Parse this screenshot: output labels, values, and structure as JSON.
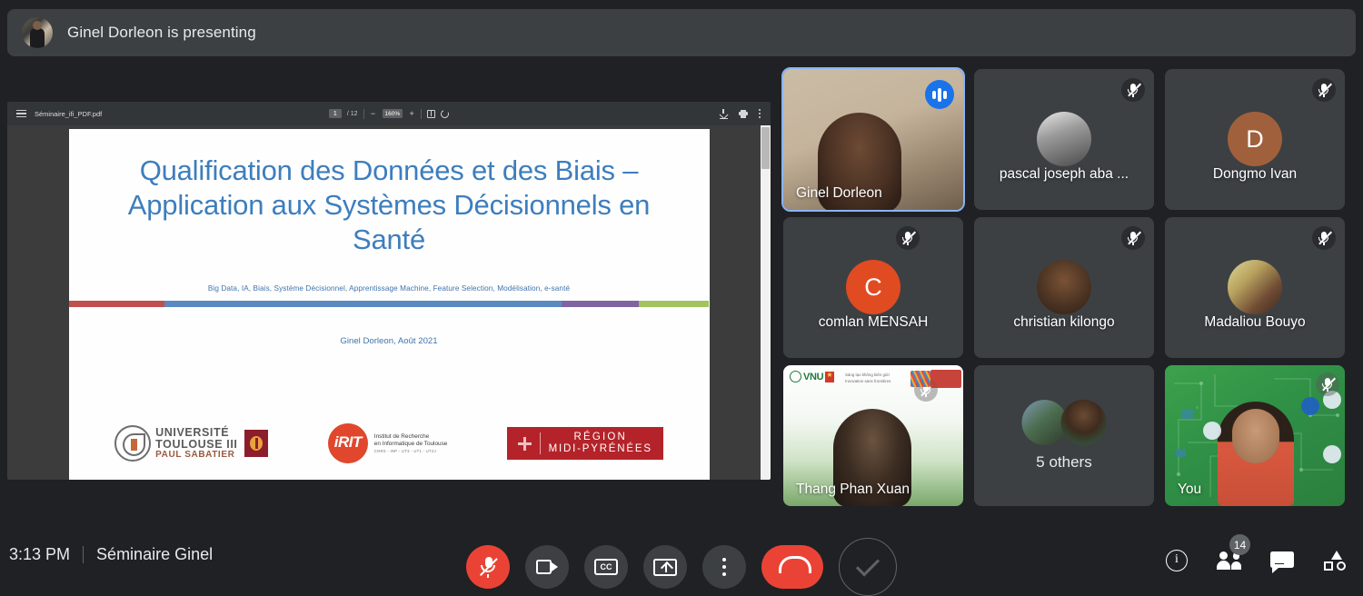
{
  "banner": {
    "text": "Ginel Dorleon is presenting",
    "avatar_icon": "presenter-avatar"
  },
  "pdf_viewer": {
    "menu_icon": "hamburger-menu-icon",
    "filename": "Séminaire_ifi_PDF.pdf",
    "current_page": "1",
    "page_total": "/ 12",
    "zoom_minus": "−",
    "zoom_level": "160%",
    "zoom_plus": "+",
    "fit_icon": "fit-to-page-icon",
    "rotate_icon": "rotate-icon",
    "download_icon": "download-icon",
    "print_icon": "print-icon",
    "more_icon": "more-options-icon"
  },
  "slide": {
    "title": "Qualification des Données et des Biais – Application aux Systèmes Décisionnels en Santé",
    "keywords": "Big Data, IA, Biais, Système Décisionnel, Apprentissage Machine, Feature Selection, Modélisation, e-santé",
    "author": "Ginel Dorleon, Août 2021",
    "color_bar": [
      {
        "color": "#c0504d",
        "width": "15%"
      },
      {
        "color": "#5b8ac1",
        "width": "62%"
      },
      {
        "color": "#8064a2",
        "width": "12%"
      },
      {
        "color": "#a3c35e",
        "width": "11%"
      }
    ],
    "logos": {
      "university": {
        "line1": "UNIVERSITÉ",
        "line2": "TOULOUSE III",
        "line3": "PAUL SABATIER"
      },
      "irit": {
        "mark": "iRIT",
        "sub1": "Institut de Recherche",
        "sub2": "en Informatique de Toulouse",
        "sub3": "CNRS - INP - UT3 - UT1 - UT2J"
      },
      "region": {
        "line1": "RÉGION",
        "line2": "MIDI-PYRÉNÉES"
      }
    }
  },
  "participants": [
    {
      "name": "Ginel Dorleon",
      "type": "video",
      "active": true,
      "speaking": true,
      "muted": false,
      "name_position": "bottom-left"
    },
    {
      "name": "pascal joseph aba ...",
      "type": "photo-avatar",
      "active": false,
      "speaking": false,
      "muted": true,
      "name_position": "centered"
    },
    {
      "name": "Dongmo Ivan",
      "type": "initial-avatar",
      "initial": "D",
      "avatar_color": "#a1603c",
      "active": false,
      "speaking": false,
      "muted": true,
      "name_position": "centered"
    },
    {
      "name": "comlan MENSAH",
      "type": "initial-avatar",
      "initial": "C",
      "avatar_color": "#e04b22",
      "active": false,
      "speaking": false,
      "muted": true,
      "name_position": "centered"
    },
    {
      "name": "christian kilongo",
      "type": "photo-avatar",
      "active": false,
      "speaking": false,
      "muted": true,
      "name_position": "centered"
    },
    {
      "name": "Madaliou Bouyo",
      "type": "photo-avatar",
      "active": false,
      "speaking": false,
      "muted": true,
      "name_position": "centered"
    },
    {
      "name": "Thang Phan Xuan",
      "type": "video",
      "active": false,
      "speaking": false,
      "muted": true,
      "name_position": "bottom-left"
    },
    {
      "name": "5 others",
      "type": "overflow",
      "active": false,
      "speaking": false,
      "muted": false,
      "name_position": "centered"
    },
    {
      "name": "You",
      "type": "video",
      "active": false,
      "speaking": false,
      "muted": true,
      "name_position": "bottom-left"
    }
  ],
  "bottom_bar": {
    "time": "3:13 PM",
    "meeting_name": "Séminaire Ginel",
    "controls": [
      {
        "name": "microphone-muted-button",
        "icon": "mic-off-icon",
        "style": "red"
      },
      {
        "name": "camera-button",
        "icon": "camera-icon",
        "style": "grey"
      },
      {
        "name": "captions-button",
        "icon": "closed-captions-icon",
        "label": "CC",
        "style": "grey"
      },
      {
        "name": "present-screen-button",
        "icon": "present-now-icon",
        "style": "grey"
      },
      {
        "name": "more-options-button",
        "icon": "more-vertical-icon",
        "style": "grey"
      },
      {
        "name": "leave-call-button",
        "icon": "hangup-icon",
        "style": "red-pill"
      },
      {
        "name": "confirm-button",
        "icon": "check-icon",
        "style": "ghost"
      }
    ],
    "right_controls": [
      {
        "name": "meeting-details-button",
        "icon": "info-icon"
      },
      {
        "name": "participants-button",
        "icon": "people-icon",
        "badge": "14"
      },
      {
        "name": "chat-button",
        "icon": "chat-icon"
      },
      {
        "name": "activities-button",
        "icon": "activities-icon"
      }
    ]
  },
  "colors": {
    "background": "#202124",
    "tile": "#3c4043",
    "accent_blue": "#8ab4f8",
    "speaking_blue": "#1a73e8",
    "red": "#ea4335",
    "slide_title_blue": "#3d7ebd"
  }
}
